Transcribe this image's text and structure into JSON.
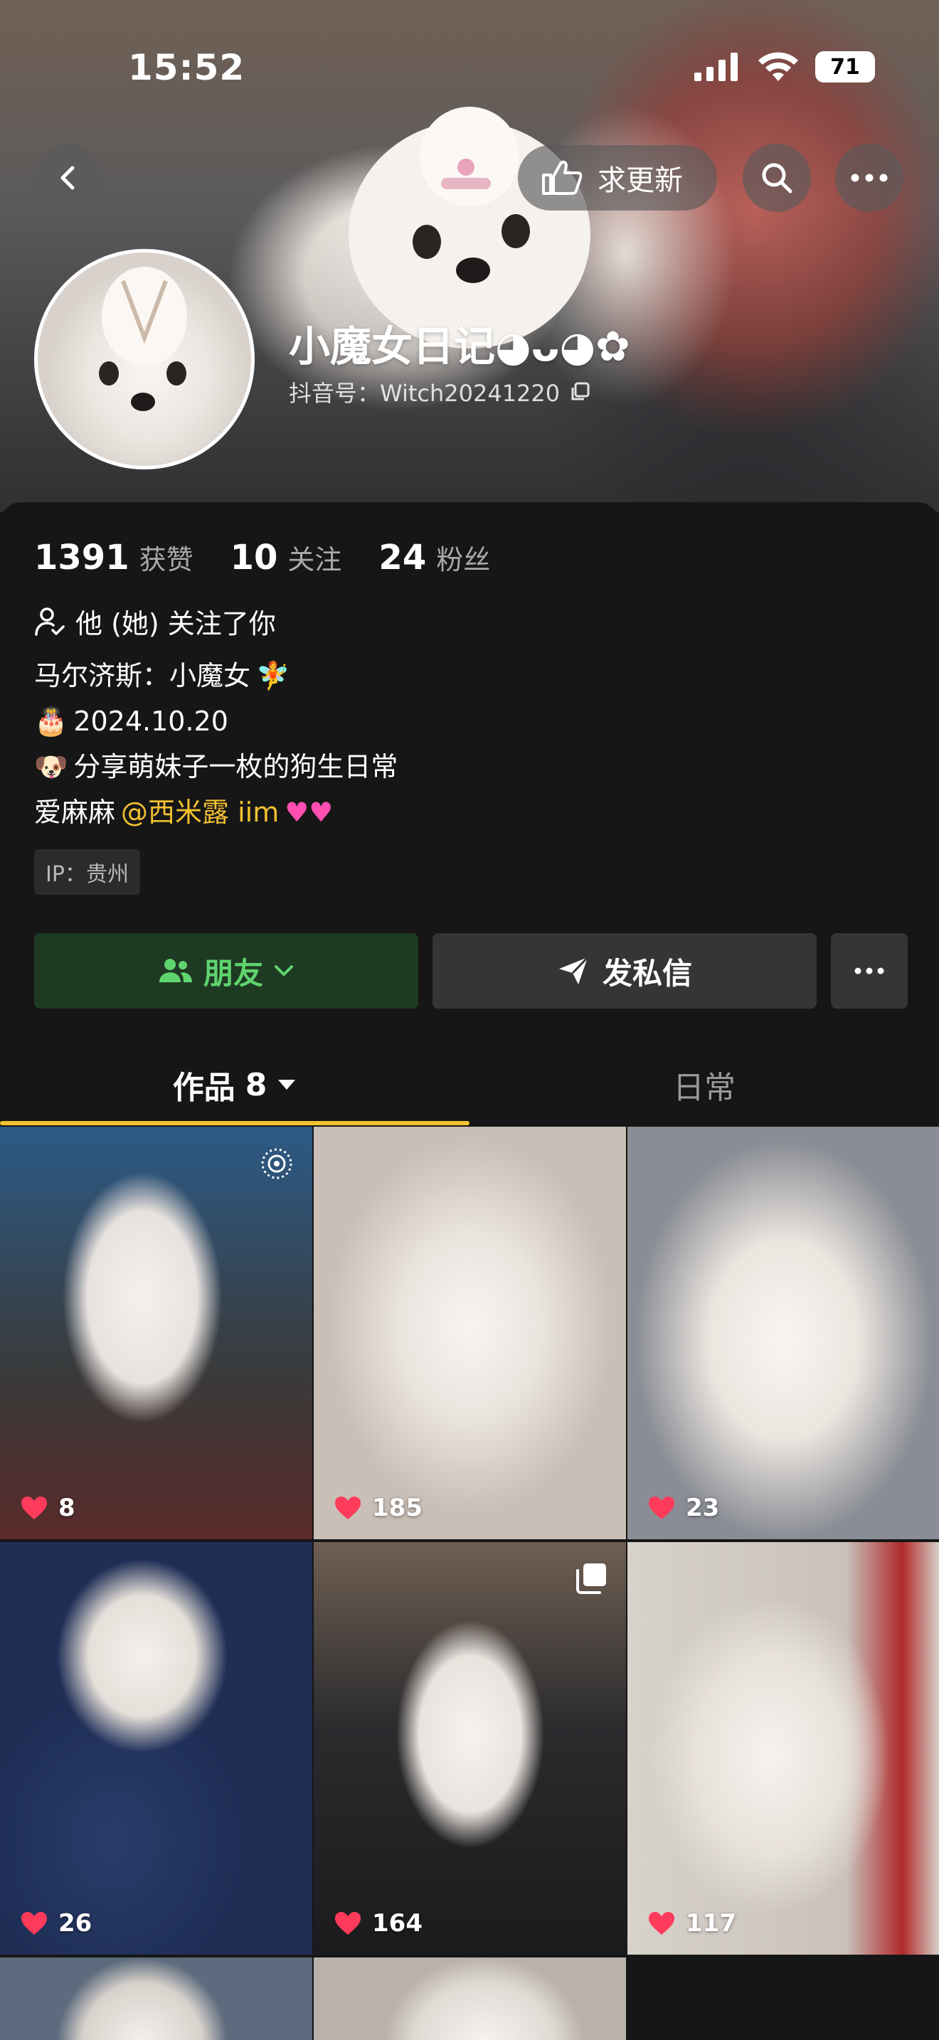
{
  "status_bar": {
    "time": "15:52",
    "battery": "71"
  },
  "header": {
    "update_label": "求更新",
    "nickname": "小魔女日记◕ᴗ◕✿",
    "douyin_id": "抖音号：Witch20241220"
  },
  "stats": [
    {
      "num": "1391",
      "label": "获赞"
    },
    {
      "num": "10",
      "label": "关注"
    },
    {
      "num": "24",
      "label": "粉丝"
    }
  ],
  "follow_status": "他 (她) 关注了你",
  "bio": {
    "line1": "马尔济斯：小魔女",
    "line2": "2024.10.20",
    "line3": "分享萌妹子一枚的狗生日常",
    "line4_prefix": "爱麻麻",
    "line4_mention": "@西米露 iim"
  },
  "ip": "IP：贵州",
  "actions": {
    "friend": "朋友",
    "message": "发私信"
  },
  "tabs": {
    "works": "作品",
    "works_count": "8",
    "daily": "日常"
  },
  "posts": [
    {
      "likes": "8"
    },
    {
      "likes": "185"
    },
    {
      "likes": "23"
    },
    {
      "likes": "26"
    },
    {
      "likes": "164"
    },
    {
      "likes": "117"
    }
  ],
  "colors": {
    "accent": "#f2c230",
    "friend_green": "#5fd46e",
    "like_red": "#ff3b5c"
  }
}
